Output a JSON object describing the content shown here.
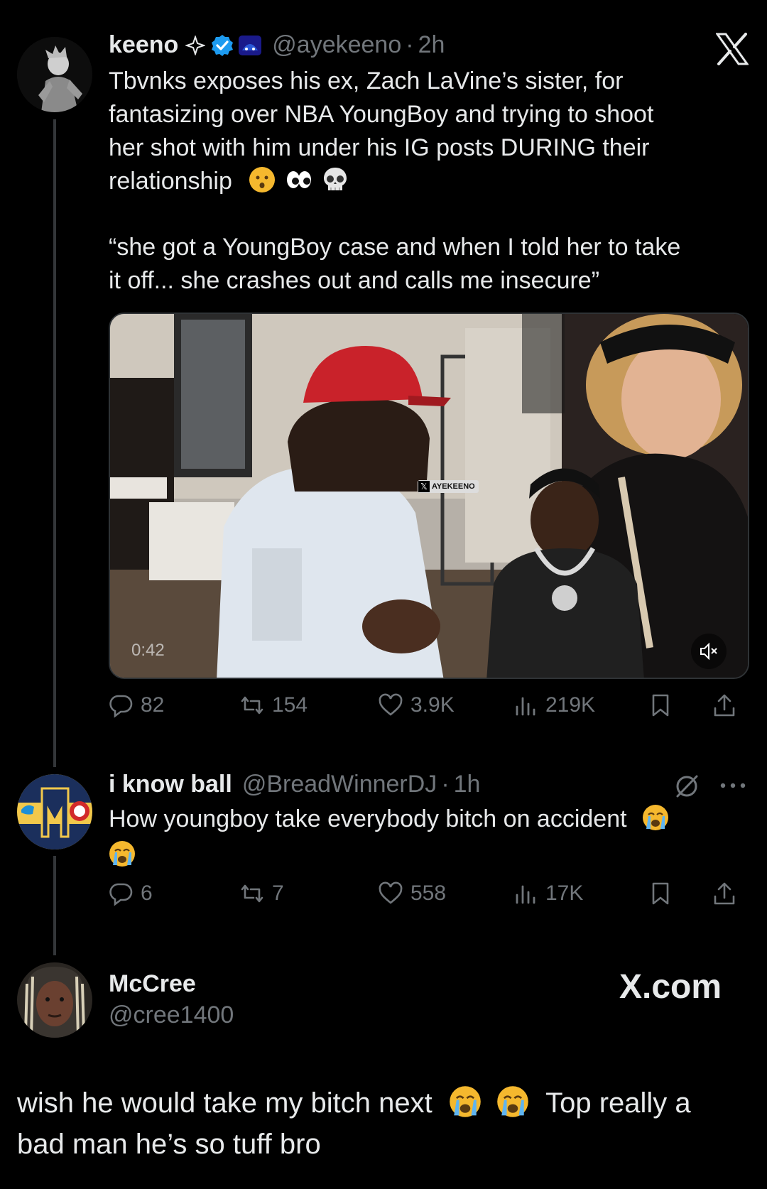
{
  "tweet1": {
    "display_name": "keeno",
    "handle": "@ayekeeno",
    "time": "2h",
    "text_line1": "Tbvnks exposes his ex, Zach LaVine’s sister, for",
    "text_line2": "fantasizing over NBA YoungBoy and trying to shoot",
    "text_line3": "her shot with him under his IG posts DURING their",
    "text_line4": "relationship",
    "quote_line1": "“she got a YoungBoy case and when I told her to take",
    "quote_line2": "it off... she crashes out and calls me insecure”",
    "video": {
      "duration": "0:42",
      "watermark": "AYEKEENO"
    },
    "stats": {
      "replies": "82",
      "reposts": "154",
      "likes": "3.9K",
      "views": "219K"
    }
  },
  "tweet2": {
    "display_name": "i know ball",
    "handle": "@BreadWinnerDJ",
    "time": "1h",
    "text_line1": "How youngboy take everybody bitch on accident",
    "stats": {
      "replies": "6",
      "reposts": "7",
      "likes": "558",
      "views": "17K"
    }
  },
  "footer": {
    "display_name": "McCree",
    "handle": "@cree1400",
    "brand": "X.com",
    "caption_line1a": "wish he would take my bitch next",
    "caption_line1b": "Top really a",
    "caption_line2": "bad man he’s so tuff bro"
  },
  "colors": {
    "background": "#000000",
    "text": "#e7e9ea",
    "muted": "#71767b",
    "verified": "#1d9bf0",
    "border": "#2f3336"
  },
  "icons": [
    "x-logo-icon",
    "reply-icon",
    "repost-icon",
    "like-icon",
    "views-icon",
    "bookmark-icon",
    "share-icon",
    "mute-icon",
    "more-icon",
    "grok-icon",
    "verified-badge-icon",
    "sparkle-icon"
  ]
}
